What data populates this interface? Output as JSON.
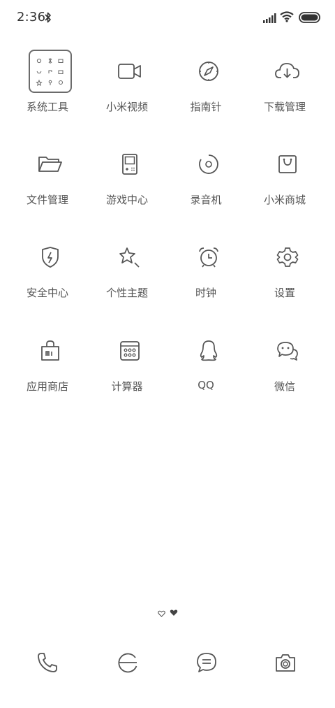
{
  "status_bar": {
    "time": "2:36",
    "icons": [
      "bluetooth-icon",
      "signal-icon",
      "wifi-icon",
      "battery-icon"
    ]
  },
  "apps": [
    {
      "label": "系统工具",
      "icon": "folder-icon"
    },
    {
      "label": "小米视频",
      "icon": "video-camera-icon"
    },
    {
      "label": "指南针",
      "icon": "compass-icon"
    },
    {
      "label": "下载管理",
      "icon": "cloud-download-icon"
    },
    {
      "label": "文件管理",
      "icon": "open-folder-icon"
    },
    {
      "label": "游戏中心",
      "icon": "gameboy-icon"
    },
    {
      "label": "录音机",
      "icon": "record-disc-icon"
    },
    {
      "label": "小米商城",
      "icon": "shopping-bag-icon"
    },
    {
      "label": "安全中心",
      "icon": "shield-lightning-icon"
    },
    {
      "label": "个性主题",
      "icon": "star-brush-icon"
    },
    {
      "label": "时钟",
      "icon": "alarm-clock-icon"
    },
    {
      "label": "设置",
      "icon": "gear-icon"
    },
    {
      "label": "应用商店",
      "icon": "mi-bag-icon"
    },
    {
      "label": "计算器",
      "icon": "calculator-icon"
    },
    {
      "label": "QQ",
      "icon": "penguin-icon"
    },
    {
      "label": "微信",
      "icon": "chat-bubbles-icon"
    }
  ],
  "page_indicator": [
    "home-heart-outline-icon",
    "page-heart-filled-icon"
  ],
  "dock": [
    {
      "icon": "phone-icon"
    },
    {
      "icon": "browser-icon"
    },
    {
      "icon": "message-icon"
    },
    {
      "icon": "camera-icon"
    }
  ]
}
